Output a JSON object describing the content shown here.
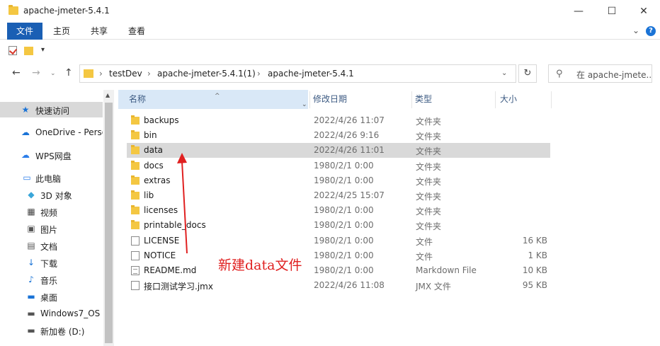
{
  "window": {
    "title": "apache-jmeter-5.4.1",
    "min_glyph": "—",
    "max_glyph": "☐",
    "close_glyph": "✕"
  },
  "ribbon": {
    "tabs": [
      "文件",
      "主页",
      "共享",
      "查看"
    ],
    "expand_glyph": "⌄",
    "help_glyph": "?"
  },
  "quick_access": {
    "dropdown_glyph": "▾"
  },
  "nav": {
    "back_glyph": "←",
    "forward_glyph": "→",
    "history_glyph": "⌄",
    "up_glyph": "↑"
  },
  "address": {
    "crumbs": [
      "testDev",
      "apache-jmeter-5.4.1(1)",
      "apache-jmeter-5.4.1"
    ],
    "separator": "›",
    "dropdown_glyph": "⌄",
    "refresh_glyph": "↻"
  },
  "search": {
    "placeholder": "在 apache-jmete...",
    "icon_glyph": "⚲"
  },
  "sidebar": {
    "items": [
      {
        "label": "快速访问",
        "icon": "star-icon",
        "glyph": "★",
        "color": "#1a73d6"
      },
      {
        "label": "OneDrive - Perso",
        "icon": "cloud-icon",
        "glyph": "☁",
        "color": "#1a73d6"
      },
      {
        "label": "WPS网盘",
        "icon": "wps-cloud-icon",
        "glyph": "☁",
        "color": "#2b7de9"
      },
      {
        "label": "此电脑",
        "icon": "computer-icon",
        "glyph": "▭",
        "color": "#2b7de9"
      },
      {
        "label": "3D 对象",
        "icon": "cube-icon",
        "glyph": "◆",
        "color": "#3aa6d9"
      },
      {
        "label": "视频",
        "icon": "video-icon",
        "glyph": "▦",
        "color": "#444"
      },
      {
        "label": "图片",
        "icon": "picture-icon",
        "glyph": "▣",
        "color": "#555"
      },
      {
        "label": "文档",
        "icon": "document-icon",
        "glyph": "▤",
        "color": "#555"
      },
      {
        "label": "下载",
        "icon": "download-icon",
        "glyph": "↓",
        "color": "#1a73d6"
      },
      {
        "label": "音乐",
        "icon": "music-icon",
        "glyph": "♪",
        "color": "#1a73d6"
      },
      {
        "label": "桌面",
        "icon": "desktop-icon",
        "glyph": "▬",
        "color": "#1a73d6"
      },
      {
        "label": "Windows7_OS",
        "icon": "drive-icon",
        "glyph": "▬",
        "color": "#555"
      },
      {
        "label": "新加卷 (D:)",
        "icon": "drive-icon",
        "glyph": "▬",
        "color": "#555"
      }
    ],
    "scroll_up_glyph": "▲"
  },
  "columns": {
    "name": "名称",
    "date": "修改日期",
    "type": "类型",
    "size": "大小",
    "sort_glyph": "^",
    "dropdown_glyph": "⌄"
  },
  "files": [
    {
      "name": "backups",
      "date": "2022/4/26 11:07",
      "type": "文件夹",
      "size": "",
      "kind": "folder"
    },
    {
      "name": "bin",
      "date": "2022/4/26 9:16",
      "type": "文件夹",
      "size": "",
      "kind": "folder"
    },
    {
      "name": "data",
      "date": "2022/4/26 11:01",
      "type": "文件夹",
      "size": "",
      "kind": "folder"
    },
    {
      "name": "docs",
      "date": "1980/2/1 0:00",
      "type": "文件夹",
      "size": "",
      "kind": "folder"
    },
    {
      "name": "extras",
      "date": "1980/2/1 0:00",
      "type": "文件夹",
      "size": "",
      "kind": "folder"
    },
    {
      "name": "lib",
      "date": "2022/4/25 15:07",
      "type": "文件夹",
      "size": "",
      "kind": "folder"
    },
    {
      "name": "licenses",
      "date": "1980/2/1 0:00",
      "type": "文件夹",
      "size": "",
      "kind": "folder"
    },
    {
      "name": "printable_docs",
      "date": "1980/2/1 0:00",
      "type": "文件夹",
      "size": "",
      "kind": "folder"
    },
    {
      "name": "LICENSE",
      "date": "1980/2/1 0:00",
      "type": "文件",
      "size": "16 KB",
      "kind": "doc"
    },
    {
      "name": "NOTICE",
      "date": "1980/2/1 0:00",
      "type": "文件",
      "size": "1 KB",
      "kind": "doc"
    },
    {
      "name": "README.md",
      "date": "1980/2/1 0:00",
      "type": "Markdown File",
      "size": "10 KB",
      "kind": "md"
    },
    {
      "name": "接口测试学习.jmx",
      "date": "2022/4/26 11:08",
      "type": "JMX 文件",
      "size": "95 KB",
      "kind": "doc"
    }
  ],
  "annotation": {
    "text": "新建data文件",
    "color": "#e02020"
  }
}
